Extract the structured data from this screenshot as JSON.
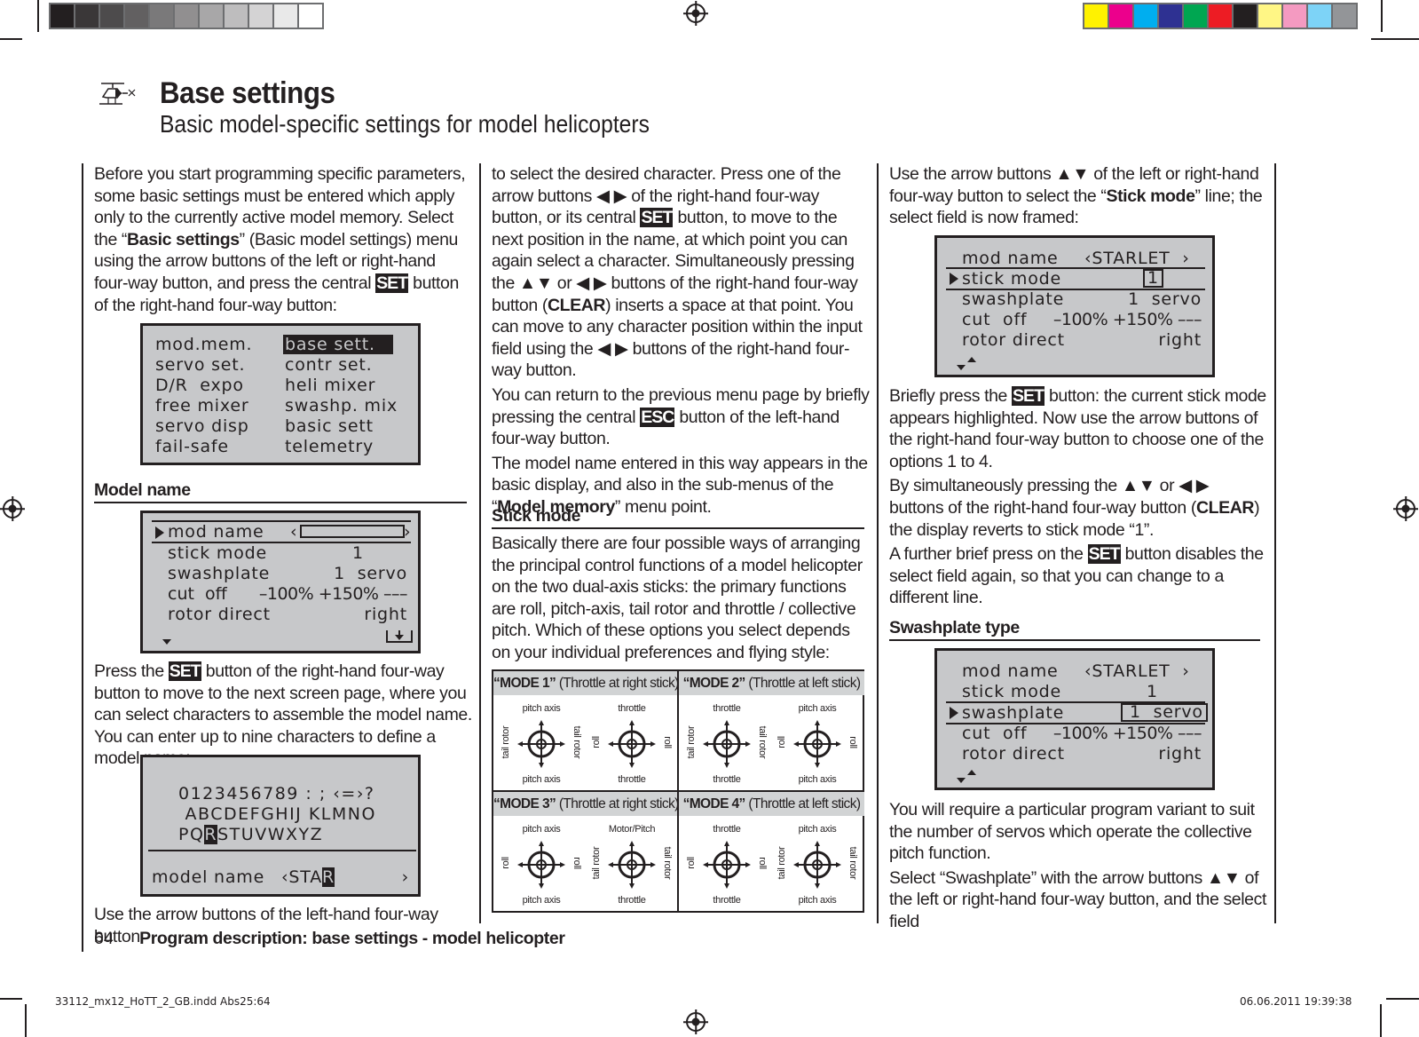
{
  "print_marks": {
    "gray_swatches": [
      "#231f20",
      "#3a3738",
      "#4d4b4c",
      "#626061",
      "#7a797a",
      "#918f90",
      "#a8a7a8",
      "#bebdbe",
      "#d4d3d4",
      "#e9e9e9",
      "#ffffff"
    ],
    "color_swatches": [
      "#fff200",
      "#ec008c",
      "#00aeef",
      "#2e3192",
      "#00a651",
      "#ed1c24",
      "#231f20",
      "#fff685",
      "#f49ac1",
      "#7dd3f7",
      "#939598"
    ]
  },
  "header": {
    "icon": "helicopter-icon",
    "title": "Base settings",
    "subtitle": "Basic model-specific settings for model helicopters"
  },
  "col1": {
    "intro": {
      "t1": "Before you start programming specific parameters, some basic settings must be entered which apply only to the currently active model memory. Select the “",
      "b1": "Basic settings",
      "t2": "” (Basic model settings) menu using the arrow buttons of the left or right-hand four-way button, and press the central ",
      "k1": "SET",
      "t3": " button of the right-hand four-way button:"
    },
    "menu_lcd": {
      "left": [
        "mod.mem.",
        "servo set.",
        "D/R  expo",
        "free mixer",
        "servo disp",
        "fail-safe"
      ],
      "right": [
        "base sett.",
        "contr set.",
        "heli mixer",
        "swashp. mix",
        "basic sett",
        "telemetry"
      ],
      "selected": "base sett."
    },
    "model_name_heading": "Model name",
    "model_lcd": {
      "rows": [
        {
          "label": "mod name",
          "value": ""
        },
        {
          "label": "stick mode",
          "value": "1"
        },
        {
          "label": "swashplate",
          "value": "1  servo"
        },
        {
          "label": "cut  off",
          "value": "–100% +150% –––"
        },
        {
          "label": "rotor direct",
          "value": "right"
        }
      ]
    },
    "p2": {
      "t1": "Press the ",
      "k1": "SET",
      "t2": " button of the right-hand four-way button to move to the next screen page, where you can select characters to assemble the model name. You can enter up to nine characters to define a model name:"
    },
    "charset_lcd": {
      "line1": "0123456789 : ; ‹=›?",
      "line2": " ABCDEFGHIJ KLMNO",
      "line3a": "PQ",
      "line3sel": "R",
      "line3b": "STUVWXYZ",
      "name_label": "model name",
      "name_value": "‹STA",
      "name_cursor": "R",
      "name_end": "›"
    },
    "p3": "Use the arrow buttons of the left-hand four-way button"
  },
  "col2": {
    "p1": {
      "t1": "to select the desired character. Press one of the arrow buttons ◀ ▶ of the right-hand four-way button, or its central ",
      "k1": "SET",
      "t2": " button, to move to the next position in the name, at which point you can again select a character. Simultaneously pressing the ▲▼ or ◀ ▶ buttons of the right-hand four-way button (",
      "b1": "CLEAR",
      "t3": ") inserts a space at that point. You can move to any character position within the input field using the ◀ ▶ buttons of the right-hand four-way button."
    },
    "p2": {
      "t1": "You can return to the previous menu page by briefly pressing the central ",
      "k1": "ESC",
      "t2": " button of the left-hand four-way button."
    },
    "p3": {
      "t1": "The model name entered in this way appears in the basic display, and also in the sub-menus of the “",
      "b1": "Model memory",
      "t2": "” menu point."
    },
    "stick_heading": "Stick mode",
    "p4": "Basically there are four possible ways of arranging the principal control functions of a model helicopter on the two dual-axis sticks: the primary functions are roll, pitch-axis, tail rotor and throttle / collective pitch. Which of these options you select depends on your individual preferences and flying style:",
    "modes": [
      {
        "name": "“MODE 1”",
        "desc": " (Throttle at right stick)",
        "left": {
          "top": "pitch axis",
          "bottom": "pitch axis",
          "l": "tail rotor",
          "r": "tail rotor"
        },
        "right": {
          "top": "throttle",
          "bottom": "throttle",
          "l": "roll",
          "r": "roll"
        }
      },
      {
        "name": "“MODE 2”",
        "desc": " (Throttle at left stick)",
        "left": {
          "top": "throttle",
          "bottom": "throttle",
          "l": "tail rotor",
          "r": "tail rotor"
        },
        "right": {
          "top": "pitch axis",
          "bottom": "pitch axis",
          "l": "roll",
          "r": "roll"
        }
      },
      {
        "name": "“MODE 3”",
        "desc": " (Throttle at right stick)",
        "left": {
          "top": "pitch axis",
          "bottom": "pitch axis",
          "l": "roll",
          "r": "roll"
        },
        "right": {
          "top": "Motor/Pitch",
          "bottom": "throttle",
          "l": "tail rotor",
          "r": "tail rotor"
        }
      },
      {
        "name": "“MODE 4”",
        "desc": " (Throttle at left stick)",
        "left": {
          "top": "throttle",
          "bottom": "throttle",
          "l": "roll",
          "r": "roll"
        },
        "right": {
          "top": "pitch axis",
          "bottom": "pitch axis",
          "l": "tail rotor",
          "r": "tail rotor"
        }
      }
    ]
  },
  "col3": {
    "p1": {
      "t1": "Use the arrow buttons ▲▼ of the left or right-hand four-way button to select the “",
      "b1": "Stick mode",
      "t2": "” line; the select field is now framed:"
    },
    "lcd_rows": [
      {
        "label": "mod name",
        "value": "‹STARLET  ›"
      },
      {
        "label": "stick mode",
        "value": "1"
      },
      {
        "label": "swashplate",
        "value": "1  servo"
      },
      {
        "label": "cut  off",
        "value": "–100% +150% –––"
      },
      {
        "label": "rotor direct",
        "value": "right"
      }
    ],
    "p2": {
      "t1": "Briefly press the ",
      "k1": "SET",
      "t2": " button: the current stick mode appears highlighted. Now use the arrow buttons of the right-hand four-way button to choose one of the options 1 to 4."
    },
    "p3": {
      "t1": "By simultaneously pressing the ▲▼ or ◀ ▶ buttons of the right-hand four-way button (",
      "b1": "CLEAR",
      "t2": ") the display reverts to stick mode “1”."
    },
    "p4": {
      "t1": "A further brief press on the ",
      "k1": "SET",
      "t2": " button disables the select field again, so that you can change to a different line."
    },
    "swash_heading": "Swashplate type",
    "p5": "You will require a particular program variant to suit the number of servos which operate the collective pitch function.",
    "p6": "Select “Swashplate” with the arrow buttons ▲▼ of the left or right-hand four-way button, and the select field"
  },
  "footer": {
    "page_number": "64",
    "section": "Program description: base settings - model helicopter",
    "slug_left": "33112_mx12_HoTT_2_GB.indd   Abs25:64",
    "slug_right": "06.06.2011   19:39:38"
  }
}
